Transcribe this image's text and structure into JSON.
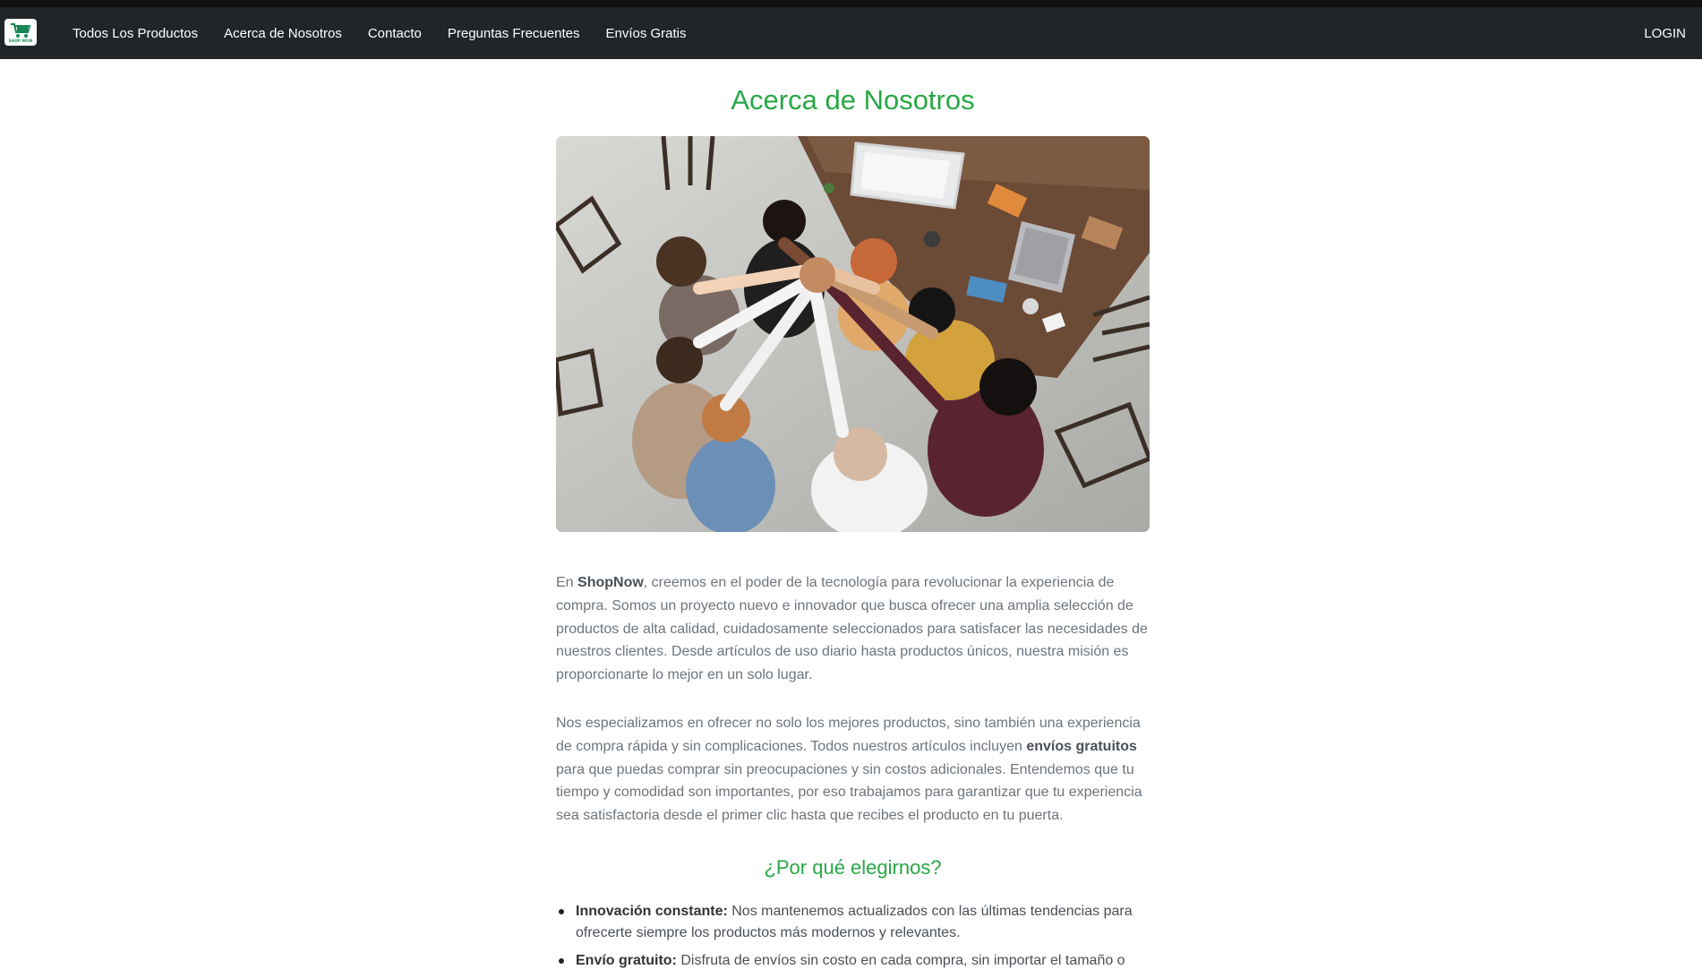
{
  "header": {
    "logo_text": "SHOP NOW",
    "nav_items": [
      {
        "label": "Todos Los Productos"
      },
      {
        "label": "Acerca de Nosotros"
      },
      {
        "label": "Contacto"
      },
      {
        "label": "Preguntas Frecuentes"
      },
      {
        "label": "Envíos Gratis"
      }
    ],
    "login_label": "LOGIN"
  },
  "main": {
    "title": "Acerca de Nosotros",
    "paragraph1": {
      "prefix": "En ",
      "brand": "ShopNow",
      "text": ", creemos en el poder de la tecnología para revolucionar la experiencia de compra. Somos un proyecto nuevo e innovador que busca ofrecer una amplia selección de productos de alta calidad, cuidadosamente seleccionados para satisfacer las necesidades de nuestros clientes. Desde artículos de uso diario hasta productos únicos, nuestra misión es proporcionarte lo mejor en un solo lugar."
    },
    "paragraph2": {
      "text_before": "Nos especializamos en ofrecer no solo los mejores productos, sino también una experiencia de compra rápida y sin complicaciones. Todos nuestros artículos incluyen ",
      "highlight": "envíos gratuitos",
      "text_after": " para que puedas comprar sin preocupaciones y sin costos adicionales. Entendemos que tu tiempo y comodidad son importantes, por eso trabajamos para garantizar que tu experiencia sea satisfactoria desde el primer clic hasta que recibes el producto en tu puerta."
    },
    "subtitle": "¿Por qué elegirnos?",
    "reasons": [
      {
        "title": "Innovación constante:",
        "text": " Nos mantenemos actualizados con las últimas tendencias para ofrecerte siempre los productos más modernos y relevantes."
      },
      {
        "title": "Envío gratuito:",
        "text": " Disfruta de envíos sin costo en cada compra, sin importar el tamaño o"
      }
    ]
  },
  "colors": {
    "navbar": "#212529",
    "accent_green": "#28a745",
    "body_text": "#6c757d"
  }
}
